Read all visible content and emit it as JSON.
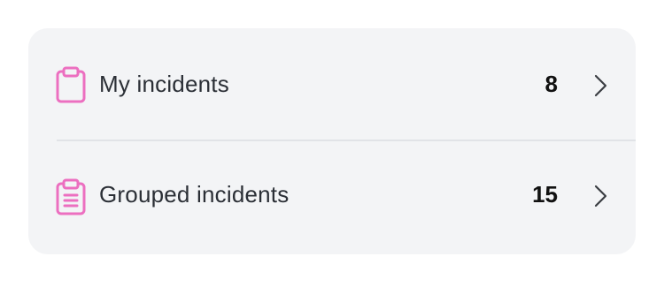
{
  "colors": {
    "icon_accent": "#ec6fc0",
    "card_background": "#f3f4f6",
    "text": "#2b2f36",
    "chevron": "#3a3d42"
  },
  "items": [
    {
      "icon": "clipboard-icon",
      "label": "My incidents",
      "count": "8"
    },
    {
      "icon": "clipboard-list-icon",
      "label": "Grouped incidents",
      "count": "15"
    }
  ]
}
